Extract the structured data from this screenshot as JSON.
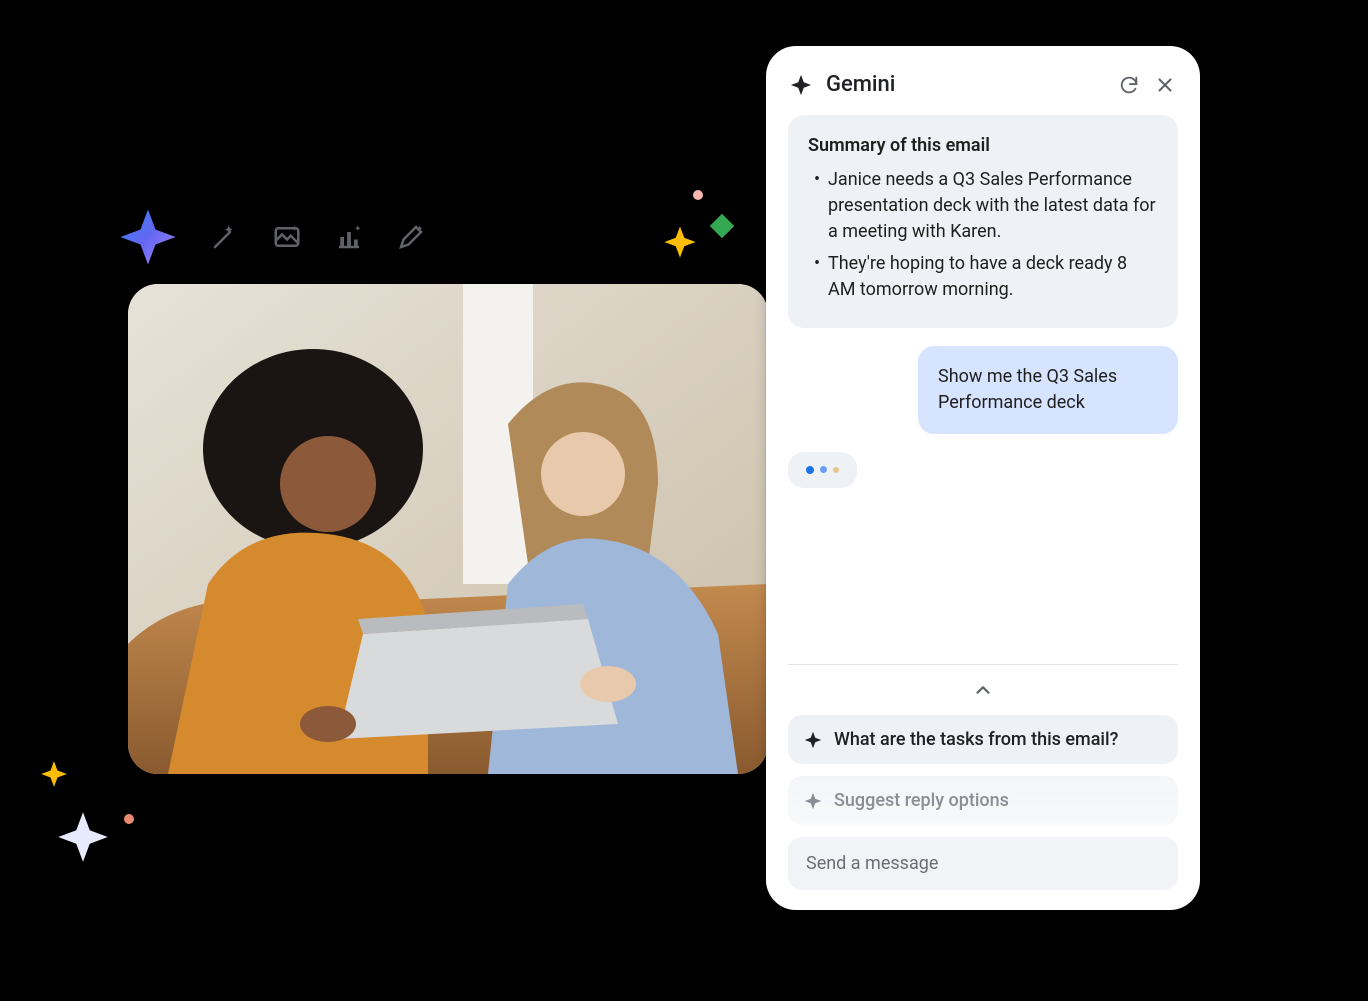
{
  "panel": {
    "title": "Gemini",
    "summary_heading": "Summary of this email",
    "summary_points": [
      "Janice needs a Q3 Sales Performance presentation deck with the latest data for a meeting with Karen.",
      "They're hoping to have a deck ready 8 AM tomorrow morning."
    ],
    "user_message": "Show me the Q3 Sales Performance deck",
    "suggestions": [
      "What are the tasks from this email?",
      "Suggest reply options"
    ],
    "input_placeholder": "Send a message"
  },
  "toolbar_icons": [
    "sparkle-icon",
    "magic-wand-icon",
    "image-sparkle-icon",
    "chart-sparkle-icon",
    "pencil-sparkle-icon"
  ],
  "colors": {
    "panel_bg": "#ffffff",
    "ai_bubble": "#eef1f6",
    "user_bubble": "#d6e4ff",
    "text": "#202124",
    "muted": "#5f6368"
  }
}
